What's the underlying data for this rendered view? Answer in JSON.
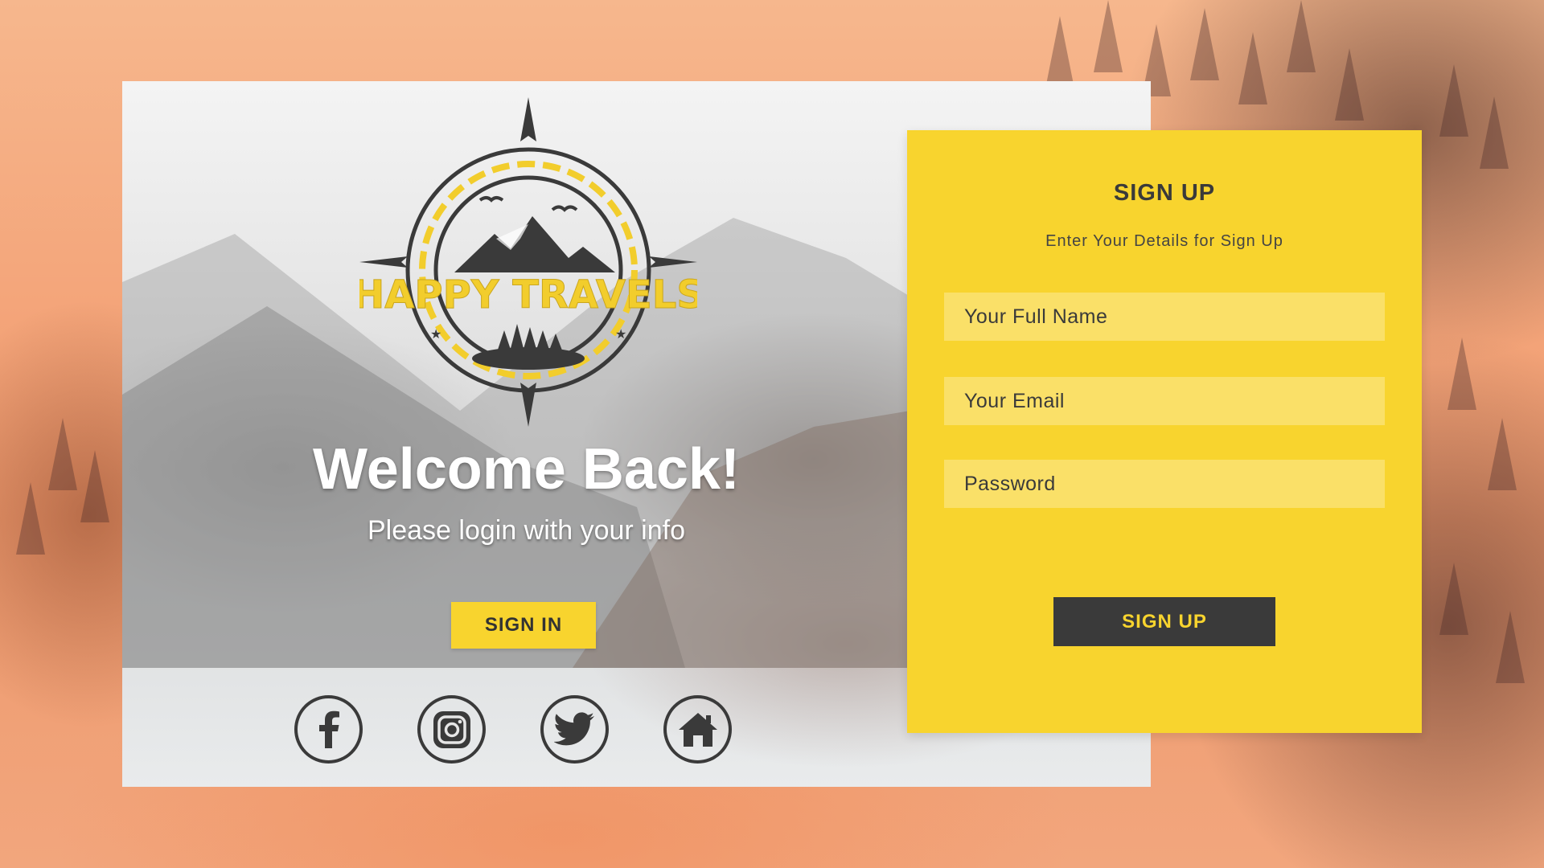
{
  "logo": {
    "text": "HAPPY TRAVELS",
    "icon": "compass-mountain-logo"
  },
  "welcome": {
    "title": "Welcome Back!",
    "subtitle": "Please login with your info",
    "sign_in_label": "SIGN IN"
  },
  "social": [
    {
      "name": "facebook",
      "icon": "facebook-icon"
    },
    {
      "name": "instagram",
      "icon": "instagram-icon"
    },
    {
      "name": "twitter",
      "icon": "twitter-icon"
    },
    {
      "name": "home",
      "icon": "home-icon"
    }
  ],
  "signup": {
    "title": "SIGN UP",
    "subtitle": "Enter Your Details for Sign Up",
    "full_name_placeholder": "Your Full Name",
    "email_placeholder": "Your Email",
    "password_placeholder": "Password",
    "button_label": "SIGN UP"
  },
  "colors": {
    "accent": "#f8d42e",
    "dark": "#3a3a3a",
    "background": "#f4a57a"
  }
}
